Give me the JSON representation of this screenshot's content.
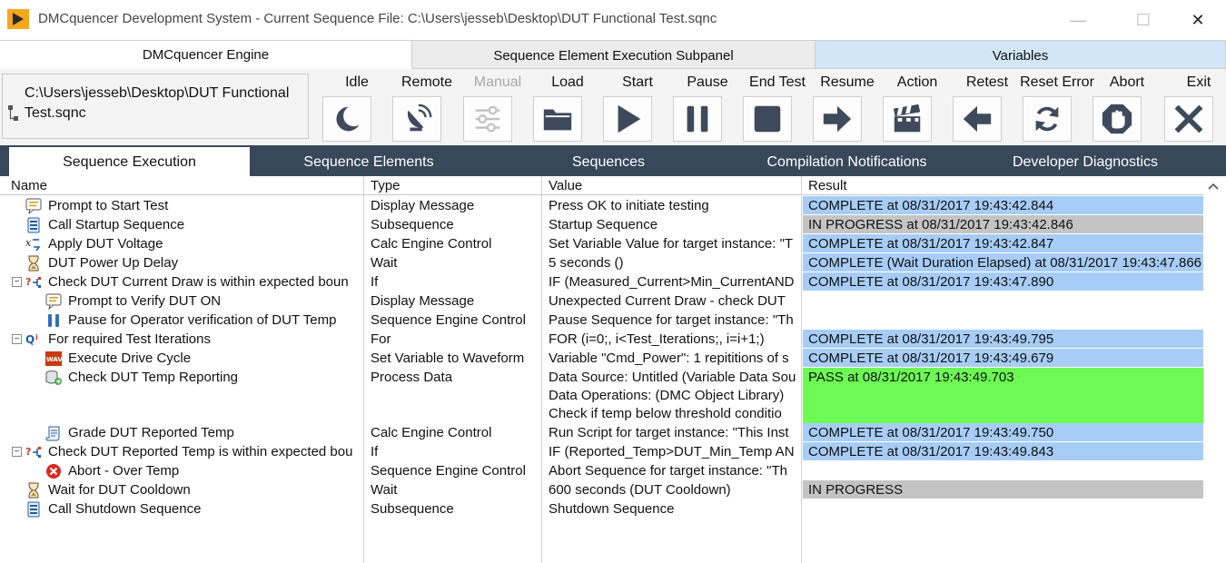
{
  "window": {
    "title": "DMCquencer Development System - Current Sequence File: C:\\Users\\jesseb\\Desktop\\DUT Functional Test.sqnc",
    "controls": {
      "minimize": "—",
      "maximize": "☐",
      "close": "✕"
    }
  },
  "top_tabs": [
    {
      "label": "DMCquencer Engine",
      "selected": true
    },
    {
      "label": "Sequence Element Execution Subpanel",
      "selected": false
    },
    {
      "label": "Variables",
      "selected": false
    }
  ],
  "toolbar": {
    "file_path": "C:\\Users\\jesseb\\Desktop\\DUT Functional Test.sqnc",
    "buttons": [
      {
        "label": "Idle",
        "icon": "moon-icon",
        "enabled": true
      },
      {
        "label": "Remote",
        "icon": "satellite-dish-icon",
        "enabled": true
      },
      {
        "label": "Manual",
        "icon": "sliders-icon",
        "enabled": false
      },
      {
        "label": "Load",
        "icon": "folder-icon",
        "enabled": true
      },
      {
        "label": "Start",
        "icon": "play-icon",
        "enabled": true
      },
      {
        "label": "Pause",
        "icon": "pause-icon",
        "enabled": true
      },
      {
        "label": "End Test",
        "icon": "stop-icon",
        "enabled": true
      },
      {
        "label": "Resume",
        "icon": "arrow-right-icon",
        "enabled": true
      },
      {
        "label": "Action",
        "icon": "clapperboard-icon",
        "enabled": true
      },
      {
        "label": "Retest",
        "icon": "arrow-left-icon",
        "enabled": true
      },
      {
        "label": "Reset Error",
        "icon": "refresh-icon",
        "enabled": true
      },
      {
        "label": "Abort",
        "icon": "hand-stop-icon",
        "enabled": true
      },
      {
        "label": "Exit",
        "icon": "x-icon",
        "enabled": true
      }
    ]
  },
  "main_tabs": [
    {
      "label": "Sequence Execution",
      "selected": true
    },
    {
      "label": "Sequence Elements",
      "selected": false
    },
    {
      "label": "Sequences",
      "selected": false
    },
    {
      "label": "Compilation Notifications",
      "selected": false
    },
    {
      "label": "Developer Diagnostics",
      "selected": false
    }
  ],
  "table": {
    "columns": [
      "Name",
      "Type",
      "Value",
      "Result"
    ],
    "rows": [
      {
        "name": "Prompt to Start Test",
        "icon": "message-icon",
        "type": "Display Message",
        "value": [
          "Press OK to initiate testing"
        ],
        "result": "COMPLETE at 08/31/2017 19:43:42.844",
        "status": "complete"
      },
      {
        "name": "Call Startup Sequence",
        "icon": "subsequence-icon",
        "type": "Subsequence",
        "value": [
          "Startup Sequence"
        ],
        "result": "IN PROGRESS at 08/31/2017 19:43:42.846",
        "status": "in-progress"
      },
      {
        "name": "Apply DUT Voltage",
        "icon": "calc-engine-icon",
        "type": "Calc Engine Control",
        "value": [
          "Set Variable Value for target instance: \"T"
        ],
        "result": "COMPLETE at 08/31/2017 19:43:42.847",
        "status": "complete"
      },
      {
        "name": "DUT Power Up Delay",
        "icon": "hourglass-icon",
        "type": "Wait",
        "value": [
          "5 seconds ()"
        ],
        "result": "COMPLETE (Wait Duration Elapsed) at 08/31/2017 19:43:47.866",
        "status": "complete"
      },
      {
        "name": "Check DUT Current Draw is within expected boun",
        "icon": "if-icon",
        "type": "If",
        "value": [
          "IF (Measured_Current>Min_CurrentAND"
        ],
        "result": "COMPLETE at 08/31/2017 19:43:47.890",
        "status": "complete"
      },
      {
        "name": "Prompt to Verify DUT ON",
        "icon": "message-icon",
        "type": "Display Message",
        "value": [
          "Unexpected Current Draw - check DUT "
        ],
        "result": "",
        "status": "none"
      },
      {
        "name": "Pause for Operator verification of DUT Temp",
        "icon": "pause-engine-icon",
        "type": "Sequence Engine Control",
        "value": [
          "Pause Sequence for target instance: \"Th"
        ],
        "result": "",
        "status": "none"
      },
      {
        "name": "For required Test Iterations",
        "icon": "for-loop-icon",
        "type": "For",
        "value": [
          "FOR (i=0;, i<Test_Iterations;, i=i+1;)"
        ],
        "result": "COMPLETE at 08/31/2017 19:43:49.795",
        "status": "complete"
      },
      {
        "name": "Execute Drive Cycle",
        "icon": "waveform-icon",
        "type": "Set Variable to Waveform",
        "value": [
          "Variable \"Cmd_Power\": 1 repititions of s"
        ],
        "result": "COMPLETE at 08/31/2017 19:43:49.679",
        "status": "complete"
      },
      {
        "name": "Check DUT Temp Reporting",
        "icon": "process-data-icon",
        "type": "Process Data",
        "value": [
          "Data Source: Untitled (Variable Data Sou",
          "Data Operations:  (DMC Object Library)",
          "Check if temp below threshold conditio"
        ],
        "result": "PASS at 08/31/2017 19:43:49.703",
        "status": "pass"
      },
      {
        "name": "Grade DUT Reported Temp",
        "icon": "script-icon",
        "type": "Calc Engine Control",
        "value": [
          "Run Script for target instance: \"This Inst"
        ],
        "result": "COMPLETE at 08/31/2017 19:43:49.750",
        "status": "complete"
      },
      {
        "name": "Check DUT Reported Temp is within expected bou",
        "icon": "if-icon",
        "type": "If",
        "value": [
          "IF (Reported_Temp>DUT_Min_Temp AN"
        ],
        "result": "COMPLETE at 08/31/2017 19:43:49.843",
        "status": "complete"
      },
      {
        "name": "Abort - Over Temp",
        "icon": "abort-icon",
        "type": "Sequence Engine Control",
        "value": [
          "Abort Sequence for target instance: \"Th"
        ],
        "result": "",
        "status": "none"
      },
      {
        "name": "Wait for DUT Cooldown",
        "icon": "hourglass-icon",
        "type": "Wait",
        "value": [
          "600 seconds (DUT Cooldown)"
        ],
        "result": "IN PROGRESS",
        "status": "in-progress"
      },
      {
        "name": "Call Shutdown Sequence",
        "icon": "subsequence-icon",
        "type": "Subsequence",
        "value": [
          "Shutdown Sequence"
        ],
        "result": "",
        "status": "none"
      }
    ]
  },
  "colors": {
    "tab_bar": "#39475a",
    "variables_tab": "#d2e6f8",
    "complete": "#a7cdf7",
    "in_progress": "#c4c4c4",
    "pass": "#6dfa55",
    "accent_orange": "#f5a81c"
  }
}
